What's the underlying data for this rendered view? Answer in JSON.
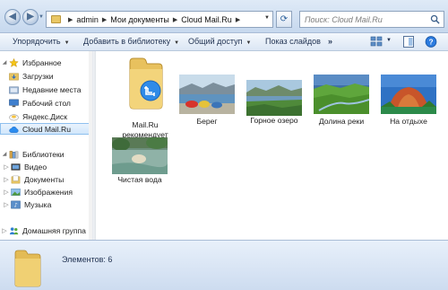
{
  "address": {
    "crumbs": [
      "admin",
      "Мои документы",
      "Cloud Mail.Ru"
    ],
    "search_placeholder": "Поиск: Cloud Mail.Ru"
  },
  "toolbar": {
    "organize": "Упорядочить",
    "add_to_library": "Добавить в библиотеку",
    "share": "Общий доступ",
    "slideshow": "Показ слайдов",
    "more": "»"
  },
  "nav": {
    "favorites": "Избранное",
    "downloads": "Загрузки",
    "recent": "Недавние места",
    "desktop": "Рабочий стол",
    "yandex": "Яндекс.Диск",
    "cloud": "Cloud Mail.Ru",
    "libraries": "Библиотеки",
    "video": "Видео",
    "documents": "Документы",
    "images": "Изображения",
    "music": "Музыка",
    "homegroup": "Домашняя группа"
  },
  "items": [
    {
      "name": "Mail.Ru\nрекомендует",
      "icon": "cloud-folder-icon"
    },
    {
      "name": "Берег",
      "icon": "photo-shore"
    },
    {
      "name": "Горное озеро",
      "icon": "photo-mountain-lake"
    },
    {
      "name": "Долина реки",
      "icon": "photo-river-valley"
    },
    {
      "name": "На отдыхе",
      "icon": "photo-vacation"
    },
    {
      "name": "Чистая вода",
      "icon": "photo-clean-water"
    }
  ],
  "status": {
    "count_text": "Элементов: 6"
  },
  "colors": {
    "accent": "#2b7be0",
    "selection": "#d0e6fb",
    "chrome": "#dbe6f4"
  }
}
